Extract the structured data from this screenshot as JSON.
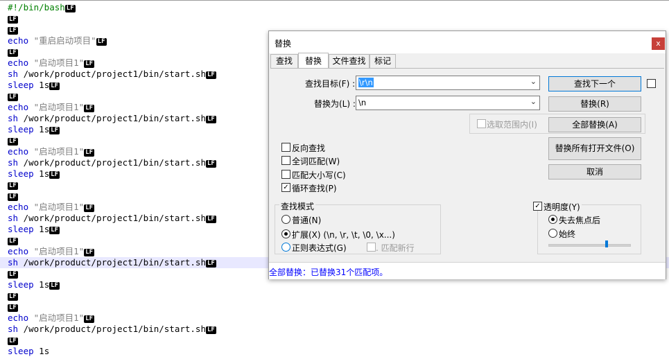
{
  "editor": {
    "lines": [
      {
        "kw": "#!/bin/bash",
        "rest": "",
        "lf": true,
        "type": "comment"
      },
      {
        "kw": "",
        "rest": "",
        "lf": true,
        "type": "empty"
      },
      {
        "kw": "",
        "rest": "",
        "lf": true,
        "type": "empty"
      },
      {
        "kw": "echo",
        "rest": " \"重启启动项目\"",
        "lf": true,
        "type": "echo"
      },
      {
        "kw": "",
        "rest": "",
        "lf": true,
        "type": "empty"
      },
      {
        "kw": "echo",
        "rest": " \"启动项目1\"",
        "lf": true,
        "type": "echo"
      },
      {
        "kw": "sh",
        "rest": " /work/product/project1/bin/start.sh",
        "lf": true,
        "type": "cmd"
      },
      {
        "kw": "sleep",
        "rest": " 1s",
        "lf": true,
        "type": "sleep"
      },
      {
        "kw": "",
        "rest": "",
        "lf": true,
        "type": "empty"
      },
      {
        "kw": "echo",
        "rest": " \"启动项目1\"",
        "lf": true,
        "type": "echo"
      },
      {
        "kw": "sh",
        "rest": " /work/product/project1/bin/start.sh",
        "lf": true,
        "type": "cmd"
      },
      {
        "kw": "sleep",
        "rest": " 1s",
        "lf": true,
        "type": "sleep"
      },
      {
        "kw": "",
        "rest": "",
        "lf": true,
        "type": "empty"
      },
      {
        "kw": "echo",
        "rest": " \"启动项目1\"",
        "lf": true,
        "type": "echo"
      },
      {
        "kw": "sh",
        "rest": " /work/product/project1/bin/start.sh",
        "lf": true,
        "type": "cmd"
      },
      {
        "kw": "sleep",
        "rest": " 1s",
        "lf": true,
        "type": "sleep"
      },
      {
        "kw": "",
        "rest": "",
        "lf": true,
        "type": "empty"
      },
      {
        "kw": "",
        "rest": "",
        "lf": true,
        "type": "empty"
      },
      {
        "kw": "echo",
        "rest": " \"启动项目1\"",
        "lf": true,
        "type": "echo"
      },
      {
        "kw": "sh",
        "rest": " /work/product/project1/bin/start.sh",
        "lf": true,
        "type": "cmd"
      },
      {
        "kw": "sleep",
        "rest": " 1s",
        "lf": true,
        "type": "sleep"
      },
      {
        "kw": "",
        "rest": "",
        "lf": true,
        "type": "empty"
      },
      {
        "kw": "echo",
        "rest": " \"启动项目1\"",
        "lf": true,
        "type": "echo"
      },
      {
        "kw": "sh",
        "rest": " /work/product/project1/bin/start.sh",
        "lf": true,
        "type": "cmd",
        "current": true
      },
      {
        "kw": "",
        "rest": "",
        "lf": true,
        "type": "empty"
      },
      {
        "kw": "sleep",
        "rest": " 1s",
        "lf": true,
        "type": "sleep"
      },
      {
        "kw": "",
        "rest": "",
        "lf": true,
        "type": "empty"
      },
      {
        "kw": "",
        "rest": "",
        "lf": true,
        "type": "empty"
      },
      {
        "kw": "echo",
        "rest": " \"启动项目1\"",
        "lf": true,
        "type": "echo"
      },
      {
        "kw": "sh",
        "rest": " /work/product/project1/bin/start.sh",
        "lf": true,
        "type": "cmd"
      },
      {
        "kw": "",
        "rest": "",
        "lf": true,
        "type": "empty"
      },
      {
        "kw": "sleep",
        "rest": " 1s",
        "lf": false,
        "type": "sleep"
      }
    ],
    "lf_marker": "LF",
    "colors": {
      "keyword": "#0000cc",
      "string": "#808080",
      "comment": "#008000",
      "current_line": "#e8e8ff"
    }
  },
  "dialog": {
    "title": "替换",
    "close": "x",
    "tabs": [
      {
        "label": "查找",
        "active": false
      },
      {
        "label": "替换",
        "active": true
      },
      {
        "label": "文件查找",
        "active": false
      },
      {
        "label": "标记",
        "active": false
      }
    ],
    "find_label": "查找目标(F) :",
    "find_value": "\\r\\n",
    "replace_label": "替换为(L) :",
    "replace_value": "\\n",
    "find_next": "查找下一个",
    "replace": "替换(R)",
    "replace_all": "全部替换(A)",
    "replace_all_open": "替换所有打开文件(O)",
    "cancel": "取消",
    "in_selection": "选取范围内(I)",
    "options": [
      {
        "label": "反向查找",
        "checked": false
      },
      {
        "label": "全词匹配(W)",
        "checked": false
      },
      {
        "label": "匹配大小写(C)",
        "checked": false
      },
      {
        "label": "循环查找(P)",
        "checked": true
      }
    ],
    "search_mode": {
      "title": "查找模式",
      "normal": "普通(N)",
      "extended": "扩展(X) (\\n, \\r, \\t, \\0, \\x...)",
      "regex": "正则表达式(G)",
      "dot_newline": ". 匹配新行",
      "selected": "extended"
    },
    "transparency": {
      "title": "透明度(Y)",
      "checked": true,
      "on_lose_focus": "失去焦点后",
      "always": "始终",
      "selected": "on_lose_focus",
      "level": 0.72
    },
    "status": "全部替换：已替换31个匹配项。"
  }
}
